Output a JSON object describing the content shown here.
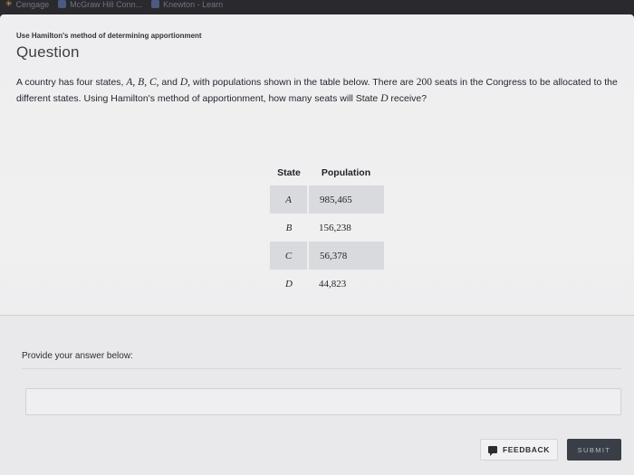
{
  "bookmarks": [
    {
      "label": "Cengage",
      "icon": "star-icon"
    },
    {
      "label": "McGraw Hill Conn...",
      "icon": "bookmark-icon"
    },
    {
      "label": "Knewton - Learn",
      "icon": "bookmark-icon"
    }
  ],
  "breadcrumb": "Use Hamilton's method of determining apportionment",
  "question": {
    "title": "Question",
    "text": {
      "p1": "A country has four states, ",
      "states": "A, B, C,",
      "p2": " and ",
      "stateD": "D,",
      "p3": " with populations shown in the table below. There are ",
      "seats": "200",
      "p4": " seats in the Congress to be allocated to the different states. Using Hamilton's method of apportionment, how many seats will State ",
      "target": "D",
      "p5": " receive?"
    }
  },
  "table": {
    "headers": [
      "State",
      "Population"
    ],
    "rows": [
      {
        "state": "A",
        "population": "985,465"
      },
      {
        "state": "B",
        "population": "156,238"
      },
      {
        "state": "C",
        "population": "56,378"
      },
      {
        "state": "D",
        "population": "44,823"
      }
    ]
  },
  "answer": {
    "label": "Provide your answer below:",
    "value": "",
    "placeholder": ""
  },
  "buttons": {
    "feedback": "FEEDBACK",
    "submit": "SUBMIT"
  },
  "colors": {
    "page_bg": "#eeeef0",
    "table_shade": "#d9dadd",
    "submit_bg": "#3a3e46"
  }
}
